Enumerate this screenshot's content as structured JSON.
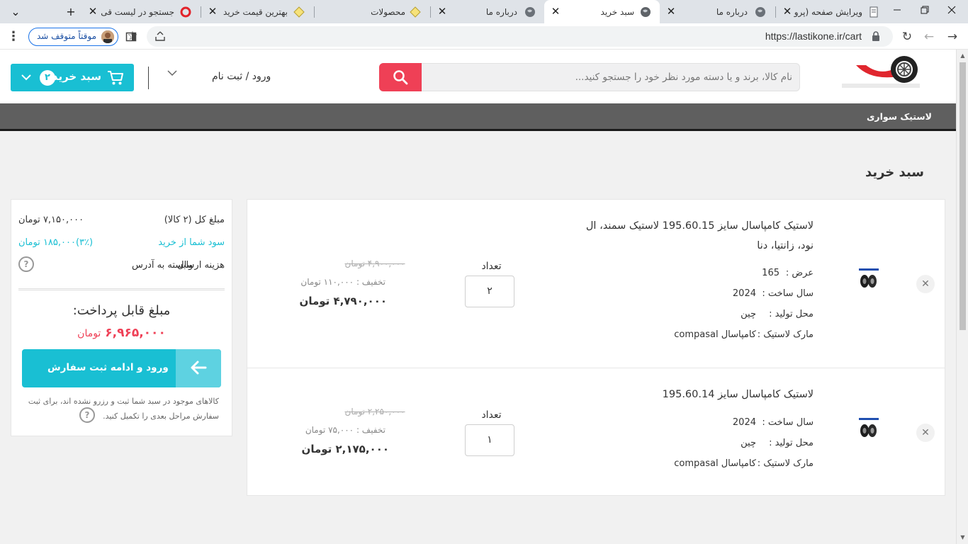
{
  "browser": {
    "tabs": [
      {
        "title": "ویرایش صفحه (پرو",
        "active": false
      },
      {
        "title": "درباره ما",
        "active": false
      },
      {
        "title": "سبد خرید",
        "active": true
      },
      {
        "title": "درباره ما",
        "active": false
      },
      {
        "title": "محصولات",
        "active": false
      },
      {
        "title": "بهترین قیمت خرید",
        "active": false
      },
      {
        "title": "جستجو در لیست قی",
        "active": false
      }
    ],
    "tab_close_glyph": "✕",
    "new_tab_glyph": "+",
    "tab_search_glyph": "⌄",
    "url": "https://lastikone.ir/cart",
    "profile_label": "موقتاً متوقف شد",
    "colors": {
      "accent": "#1a73e8",
      "strip": "#dfe3e8"
    }
  },
  "header": {
    "search_placeholder": "نام کالا، برند و یا دسته مورد نظر خود را جستجو کنید...",
    "login_label": "ورود / ثبت نام",
    "cart_label": "سبد خرید",
    "cart_count": "۲",
    "icons": [
      "search-icon",
      "cart-icon",
      "chevron-down-icon",
      "logo-icon"
    ]
  },
  "nav": {
    "items": [
      "لاستیک سواری"
    ]
  },
  "page": {
    "title": "سبد خرید"
  },
  "cart": {
    "qty_label": "تعداد",
    "items": [
      {
        "name": "لاستیک کامپاسال سایز 195.60.15 لاستیک سمند، ال نود، زانتیا، دنا",
        "attrs": [
          {
            "label": "عرض :",
            "value": "165"
          },
          {
            "label": "سال ساخت :",
            "value": "2024"
          },
          {
            "label": "محل تولید :",
            "value": "چین"
          },
          {
            "label": "مارک لاستیک :",
            "value": "کامپاسال compasal"
          }
        ],
        "qty": "۲",
        "old_price": "۴,۹۰۰,۰۰۰ تومان",
        "discount": "تخفیف : ۱۱۰,۰۰۰ تومان",
        "price": "۴,۷۹۰,۰۰۰ تومان"
      },
      {
        "name": "لاستیک کامپاسال سایز 195.60.14",
        "attrs": [
          {
            "label": "سال ساخت :",
            "value": "2024"
          },
          {
            "label": "محل تولید :",
            "value": "چین"
          },
          {
            "label": "مارک لاستیک :",
            "value": "کامپاسال compasal"
          }
        ],
        "qty": "۱",
        "old_price": "۲,۲۵۰,۰۰۰ تومان",
        "discount": "تخفیف : ۷۵,۰۰۰ تومان",
        "price": "۲,۱۷۵,۰۰۰ تومان"
      }
    ]
  },
  "summary": {
    "total_label": "مبلغ کل (۲ کالا)",
    "total_value": "۷,۱۵۰,۰۰۰ تومان",
    "profit_label": "سود شما از خرید",
    "profit_value": "(۳٪)۱۸۵,۰۰۰ تومان",
    "shipping_label": "هزینه ارسال",
    "shipping_value": "وابسته به آدرس",
    "payable_label": "مبلغ قابل پرداخت:",
    "payable_amount": "۶,۹۶۵,۰۰۰",
    "payable_currency": "تومان",
    "checkout_label": "ورود و ادامه ثبت سفارش",
    "note": "کالاهای موجود در سبد شما ثبت و رزرو نشده اند، برای ثبت سفارش مراحل بعدی را تکمیل کنید.",
    "colors": {
      "accent": "#19bfd3",
      "price_red": "#ef4056"
    }
  }
}
